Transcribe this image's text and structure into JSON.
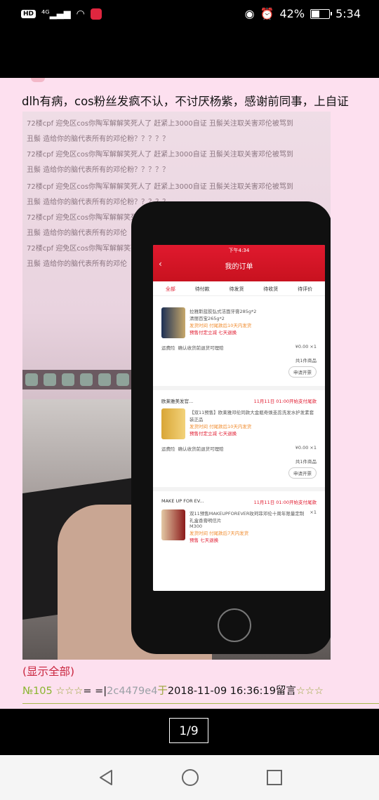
{
  "status_bar": {
    "hd": "HD",
    "network": "⁴ᴳ",
    "battery_percent": "42%",
    "time": "5:34"
  },
  "post": {
    "text": "dlh有病，cos粉丝发疯不认，不讨厌杨紫，感谢前同事，上自证",
    "show_all": "(显示全部)",
    "number": "№105",
    "stars": "☆☆☆",
    "separator": "= =|",
    "user_id": "2c4479e4",
    "at": "于",
    "datetime": "2018-11-09 16:36:19",
    "suffix": "留言",
    "end_stars": "☆☆☆"
  },
  "photo": {
    "screen_lines": [
      "72楼cpf 迎免区cos你陶军解解笑死人了 赶紧上3000自证 丑鬃关注取关害邓伦被骂到",
      "丑鬃 造给你的脑代表所有的邓伦粉？？？？？",
      "72楼cpf 迎免区cos你陶军解解笑死人了 赶紧上3000自证 丑鬃关注取关害邓伦被骂到",
      "丑鬃 造给你的脑代表所有的邓伦粉？？？？？",
      "72楼cpf 迎免区cos你陶军解解笑死人了 赶紧上3000自证 丑鬃关注取关害邓伦被骂到",
      "丑鬃 造给你的脑代表所有的邓伦粉？？？？？",
      "72楼cpf 迎免区cos你陶军解解笑死人了",
      "丑鬃 造给你的脑代表所有的邓伦",
      "72楼cpf 迎免区cos你陶军解解笑死",
      "丑鬃 造给你的脑代表所有的邓伦"
    ],
    "app": {
      "time": "下午4:34",
      "title": "我的订单",
      "tabs": [
        "全部",
        "待付款",
        "待发货",
        "待收货",
        "待评价"
      ],
      "orders": [
        {
          "shop": "",
          "status": "",
          "title": "拉雅斯蓝胶弘式洁面牙膏285g*2",
          "sub": "清丽百宝265g*2",
          "ship": "发货时间 付尾款后10天内发货",
          "tags": "预售付定立减  七天退换",
          "insurance_label": "运费险",
          "insurance_text": "确认收货前退货可理赔",
          "price": "¥0.00 ×1",
          "count": "共1件商品",
          "action": "申请开票"
        },
        {
          "shop": "欧莱雅美发官...",
          "status": "11月11日 01:00开始支付尾款",
          "title": "【双11预售】欧莱雅邓伦同款大金瓶奇焕韭蕊洗发水护发素套装正品",
          "sub": "",
          "ship": "发货时间 付尾款后10天内发货",
          "tags": "预售付定立减  七天退换",
          "insurance_label": "运费险",
          "insurance_text": "确认收货前退货可理赔",
          "price": "¥0.00 ×1",
          "count": "共1件商品",
          "action": "申请开票"
        },
        {
          "shop": "MAKE UP FOR EV...",
          "status": "11月11日 01:00开始支付尾款",
          "title": "双11预售MAKEUPFOREVER玫珂菲邓伦十周年限量定制礼盒香膏明信片",
          "sub": "M300",
          "ship": "发货时间 付尾款后7天内发货",
          "tags": "预售  七天退换",
          "insurance_label": "",
          "insurance_text": "",
          "price": "×1",
          "count": "",
          "action": ""
        }
      ]
    }
  },
  "pager": {
    "label": "1/9"
  }
}
